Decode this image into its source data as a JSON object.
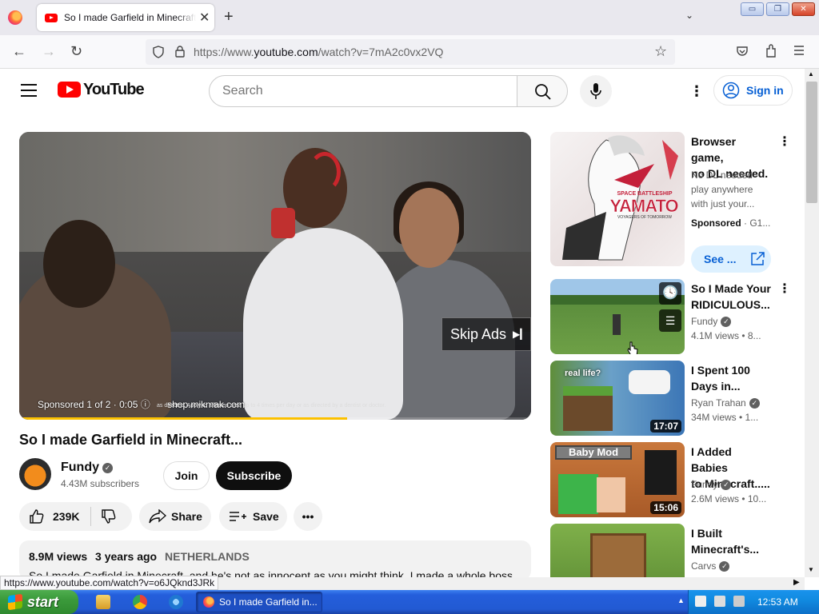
{
  "browser": {
    "tab_title": "So I made Garfield in Minecraft",
    "tab_close": "✕",
    "new_tab": "+",
    "tab_list": "⌄",
    "url_prefix": "https://www.",
    "url_host": "youtube.com",
    "url_path": "/watch?v=7mA2c0vx2VQ",
    "status_url": "https://www.youtube.com/watch?v=o6JQknd3JRk"
  },
  "window_controls": {
    "minimize": "▭",
    "maximize": "❐",
    "close": "✕"
  },
  "yt": {
    "logo_text": "YouTube",
    "search_placeholder": "Search",
    "sign_in": "Sign in",
    "accent": "#ff0000",
    "link_color": "#065fd4"
  },
  "player": {
    "ad_info": "Sponsored 1 of 2 · 0:05",
    "ad_link": "shop.mikmak.com",
    "ad_fine_print": "as directed. Apply to affected area up to 4 times per day or as directed by a dentist or doctor.",
    "skip_label": "Skip Ads",
    "ad_progress": 0.64
  },
  "video": {
    "title": "So I made Garfield in Minecraft...",
    "channel": "Fundy",
    "subscribers": "4.43M subscribers",
    "join": "Join",
    "subscribe": "Subscribe",
    "likes": "239K",
    "share": "Share",
    "save": "Save",
    "views": "8.9M views",
    "age": "3 years ago",
    "location": "NETHERLANDS",
    "description": "So I made Garfield in Minecraft, and he's not as innocent as you might think. I made a whole boss"
  },
  "sidebar": {
    "ad": {
      "title_1": "Browser game,",
      "title_2": "no DL needed.",
      "desc_1": "No DL needed -",
      "desc_2": "play anywhere",
      "desc_3": "with just your...",
      "sponsored": "Sponsored",
      "advertiser": "G1...",
      "see_button": "See ...",
      "thumb_text_1": "SPACE BATTLESHIP",
      "thumb_text_2": "YAMATO",
      "thumb_text_3": "VOYAGERS OF TOMORROW"
    },
    "videos": [
      {
        "title_1": "So I Made Your",
        "title_2": "RIDICULOUS...",
        "channel": "Fundy",
        "meta": "4.1M views  • 8..."
      },
      {
        "title_1": "I Spent 100",
        "title_2": "Days in...",
        "channel": "Ryan Trahan",
        "meta": "34M views  • 1...",
        "duration": "17:07",
        "thumb_label": "real life?"
      },
      {
        "title_1": "I Added Babies",
        "title_2": "to Minecraft.....",
        "channel": "Fundy",
        "meta": "2.6M views  • 10...",
        "duration": "15:06",
        "thumb_label": "Baby Mod"
      },
      {
        "title_1": "I Built",
        "title_2": "Minecraft's...",
        "channel": "Carvs"
      }
    ]
  },
  "taskbar": {
    "start": "start",
    "active_task": "So I made Garfield in...",
    "clock": "12:53 AM"
  }
}
